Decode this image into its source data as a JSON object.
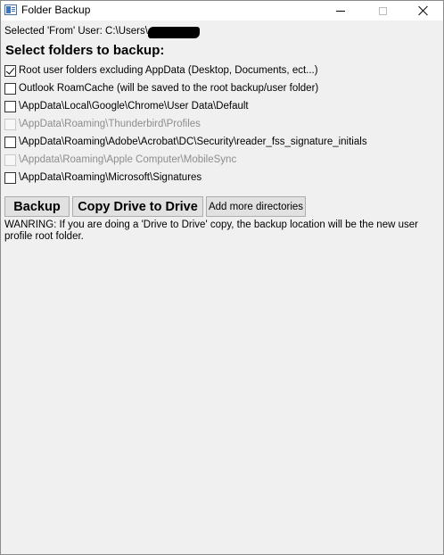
{
  "window": {
    "title": "Folder Backup"
  },
  "selected_user": {
    "text": "Selected 'From' User: C:\\Users\\"
  },
  "heading": "Select folders to backup:",
  "folders": [
    {
      "label": "Root user folders excluding AppData (Desktop, Documents, ect...)",
      "checked": true,
      "enabled": true
    },
    {
      "label": "Outlook RoamCache (will be saved to the root backup/user folder)",
      "checked": false,
      "enabled": true
    },
    {
      "label": "\\AppData\\Local\\Google\\Chrome\\User Data\\Default",
      "checked": false,
      "enabled": true
    },
    {
      "label": "\\AppData\\Roaming\\Thunderbird\\Profiles",
      "checked": false,
      "enabled": false
    },
    {
      "label": "\\AppData\\Roaming\\Adobe\\Acrobat\\DC\\Security\\reader_fss_signature_initials",
      "checked": false,
      "enabled": true
    },
    {
      "label": "\\Appdata\\Roaming\\Apple Computer\\MobileSync",
      "checked": false,
      "enabled": false
    },
    {
      "label": "\\AppData\\Roaming\\Microsoft\\Signatures",
      "checked": false,
      "enabled": true
    }
  ],
  "buttons": {
    "backup": "Backup",
    "copy_drive": "Copy Drive to Drive",
    "add_dirs": "Add more directories"
  },
  "warning": "WANRING: If you are doing a 'Drive to Drive' copy, the backup location will be the new user profile root folder."
}
